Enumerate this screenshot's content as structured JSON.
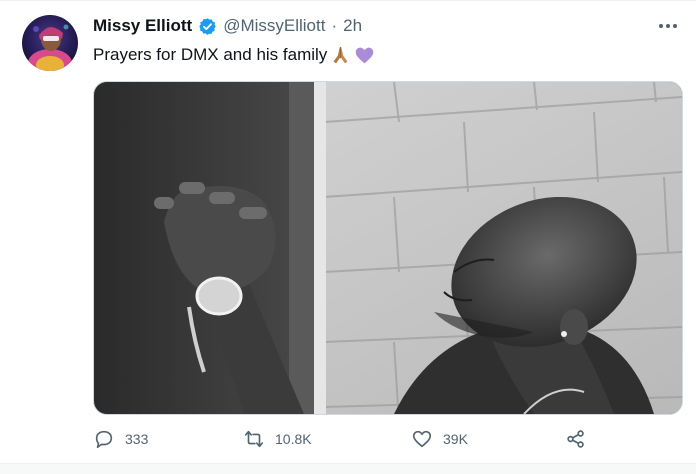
{
  "author": {
    "name": "Missy Elliott",
    "handle": "@MissyElliott",
    "separator": "·",
    "time": "2h",
    "verified": true
  },
  "tweet": {
    "text": "Prayers for DMX and his family",
    "emojis": [
      "folded-hands-icon",
      "purple-heart-icon"
    ]
  },
  "media": {
    "type": "photo",
    "style": "black-and-white"
  },
  "actions": {
    "reply_count": "333",
    "retweet_count": "10.8K",
    "like_count": "39K"
  },
  "colors": {
    "verified_blue": "#1d9bf0",
    "secondary_text": "#536471",
    "purple_heart": "#a98bd6",
    "border": "#cfd9de"
  }
}
